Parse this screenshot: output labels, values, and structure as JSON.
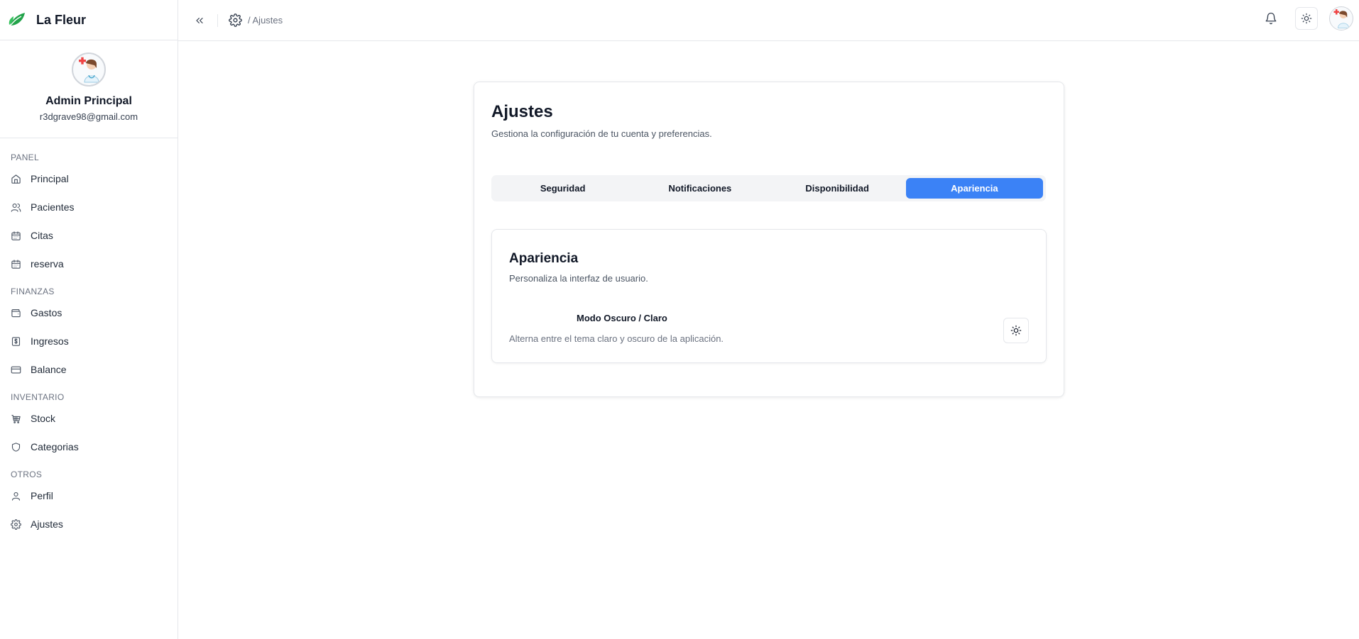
{
  "brand": {
    "name": "La Fleur"
  },
  "profile": {
    "name": "Admin Principal",
    "email": "r3dgrave98@gmail.com"
  },
  "sidebar": {
    "sections": [
      {
        "title": "PANEL",
        "items": [
          {
            "label": "Principal",
            "icon": "home-icon"
          },
          {
            "label": "Pacientes",
            "icon": "users-icon"
          },
          {
            "label": "Citas",
            "icon": "calendar-icon"
          },
          {
            "label": "reserva",
            "icon": "calendar-icon"
          }
        ]
      },
      {
        "title": "FINANZAS",
        "items": [
          {
            "label": "Gastos",
            "icon": "wallet-icon"
          },
          {
            "label": "Ingresos",
            "icon": "dollar-receipt-icon"
          },
          {
            "label": "Balance",
            "icon": "credit-card-icon"
          }
        ]
      },
      {
        "title": "INVENTARIO",
        "items": [
          {
            "label": "Stock",
            "icon": "cart-icon"
          },
          {
            "label": "Categorias",
            "icon": "shield-icon"
          }
        ]
      },
      {
        "title": "OTROS",
        "items": [
          {
            "label": "Perfil",
            "icon": "user-icon"
          },
          {
            "label": "Ajustes",
            "icon": "gear-icon"
          }
        ]
      }
    ]
  },
  "topbar": {
    "breadcrumb": "/ Ajustes"
  },
  "settings": {
    "title": "Ajustes",
    "subtitle": "Gestiona la configuración de tu cuenta y preferencias.",
    "tabs": [
      {
        "label": "Seguridad",
        "active": false
      },
      {
        "label": "Notificaciones",
        "active": false
      },
      {
        "label": "Disponibilidad",
        "active": false
      },
      {
        "label": "Apariencia",
        "active": true
      }
    ],
    "appearance": {
      "title": "Apariencia",
      "subtitle": "Personaliza la interfaz de usuario.",
      "mode_label": "Modo Oscuro / Claro",
      "mode_desc": "Alterna entre el tema claro y oscuro de la aplicación."
    }
  },
  "colors": {
    "accent": "#3b82f6",
    "brand_leaf": "#22a34a"
  }
}
